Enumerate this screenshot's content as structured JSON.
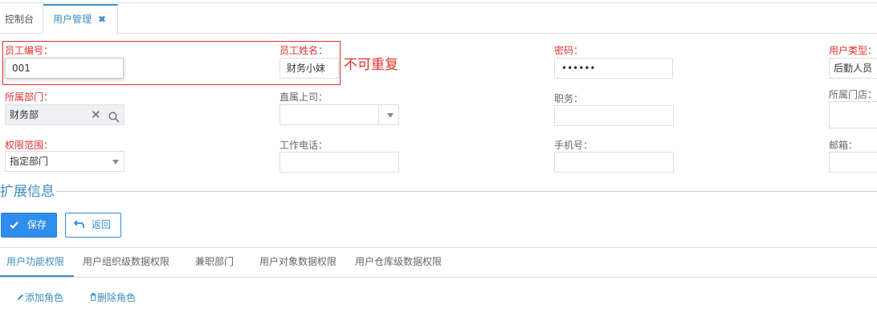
{
  "tabs": [
    {
      "label": "控制台"
    },
    {
      "label": "用户管理",
      "close": "✖"
    }
  ],
  "form": {
    "emp_no": {
      "label": "员工编号：",
      "value": "001"
    },
    "emp_name": {
      "label": "员工姓名：",
      "value": "财务小妹"
    },
    "password": {
      "label": "密码：",
      "value": "••••••"
    },
    "user_type": {
      "label": "用户类型：",
      "value": "后勤人员"
    },
    "dept": {
      "label": "所属部门：",
      "value": "财务部"
    },
    "supervisor": {
      "label": "直属上司：",
      "value": ""
    },
    "position": {
      "label": "职务：",
      "value": ""
    },
    "store": {
      "label": "所属门店：",
      "value": ""
    },
    "scope": {
      "label": "权限范围：",
      "value": "指定部门"
    },
    "work_phone": {
      "label": "工作电话：",
      "value": ""
    },
    "mobile": {
      "label": "手机号：",
      "value": ""
    },
    "email": {
      "label": "邮箱：",
      "value": ""
    }
  },
  "annotation": "不可重复",
  "section_title": "扩展信息",
  "buttons": {
    "save": "保存",
    "back": "返回"
  },
  "subtabs": [
    "用户功能权限",
    "用户组织级数据权限",
    "兼职部门",
    "用户对象数据权限",
    "用户仓库级数据权限"
  ],
  "links": {
    "add_role": "添加角色",
    "delete_role": "删除角色"
  },
  "colors": {
    "accent": "#3c8dbc",
    "required": "#e0312d",
    "primary_button": "#2e8ded"
  }
}
